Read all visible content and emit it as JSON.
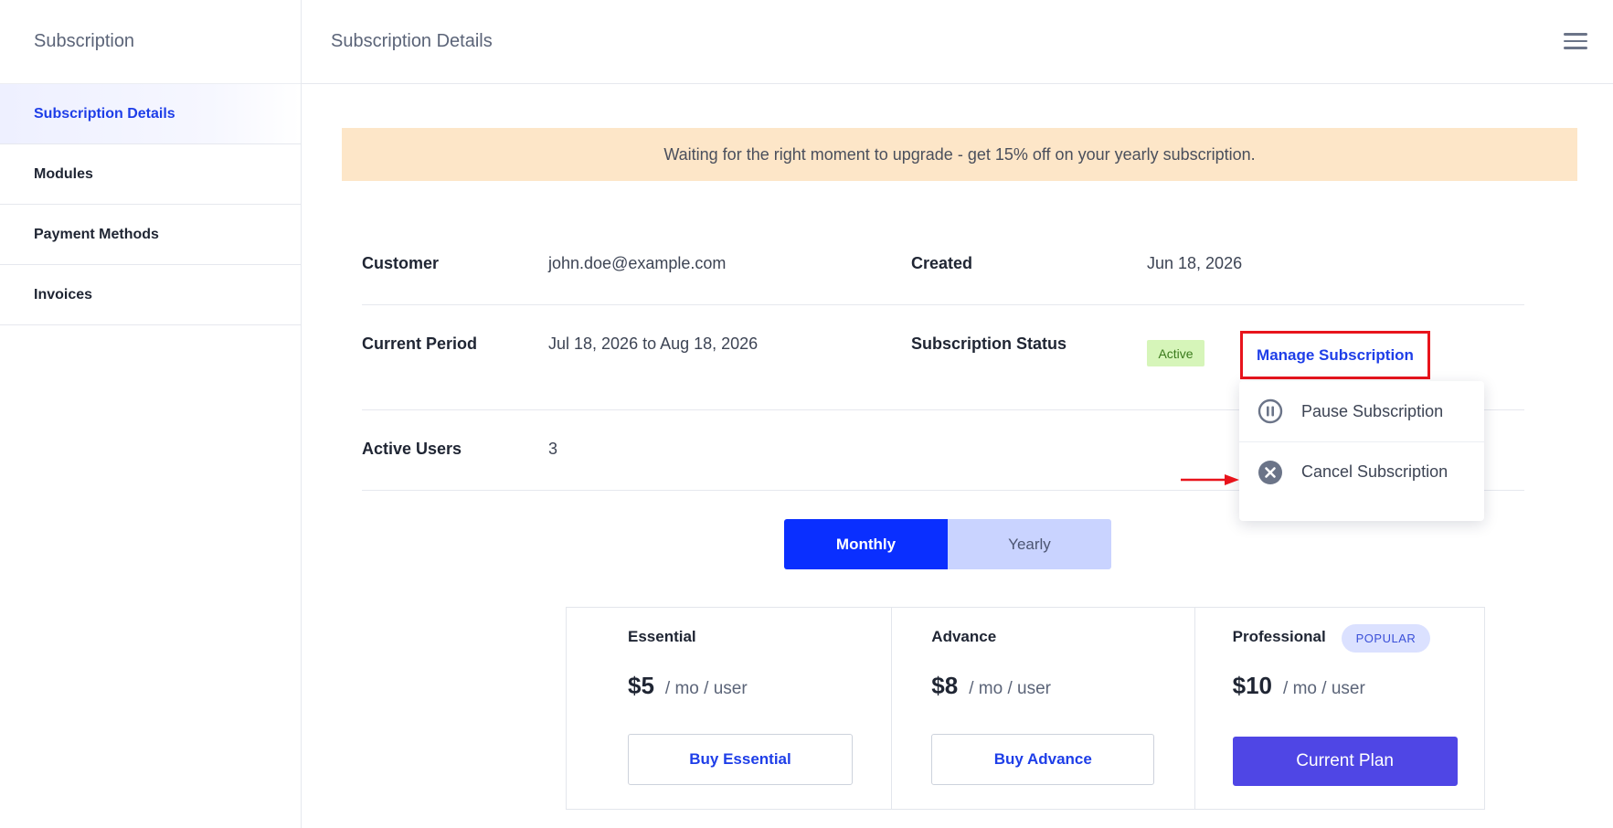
{
  "sidebar": {
    "title": "Subscription",
    "items": [
      {
        "label": "Subscription Details",
        "active": true
      },
      {
        "label": "Modules",
        "active": false
      },
      {
        "label": "Payment Methods",
        "active": false
      },
      {
        "label": "Invoices",
        "active": false
      }
    ]
  },
  "header": {
    "title": "Subscription Details",
    "menu_icon": "hamburger-menu-icon"
  },
  "banner": {
    "text": "Waiting for the right moment to upgrade - get 15% off on your yearly subscription."
  },
  "details": {
    "customer_label": "Customer",
    "customer_value": "john.doe@example.com",
    "created_label": "Created",
    "created_value": "Jun 18, 2026",
    "period_label": "Current Period",
    "period_value": "Jul 18, 2026 to Aug 18, 2026",
    "status_label": "Subscription Status",
    "status_value": "Active",
    "users_label": "Active Users",
    "users_value": "3"
  },
  "manage": {
    "label": "Manage Subscription",
    "menu": [
      {
        "label": "Pause Subscription",
        "icon": "pause-circle-icon"
      },
      {
        "label": "Cancel Subscription",
        "icon": "cancel-circle-icon"
      }
    ]
  },
  "billing_toggle": {
    "monthly": "Monthly",
    "yearly": "Yearly",
    "selected": "Monthly"
  },
  "plans": [
    {
      "name": "Essential",
      "price": "$5",
      "unit": "/ mo / user",
      "button": "Buy Essential",
      "current": false
    },
    {
      "name": "Advance",
      "price": "$8",
      "unit": "/ mo / user",
      "button": "Buy Advance",
      "current": false
    },
    {
      "name": "Professional",
      "price": "$10",
      "unit": "/ mo / user",
      "button": "Current Plan",
      "current": true,
      "badge": "POPULAR"
    }
  ],
  "colors": {
    "accent": "#1e3ee8",
    "banner_bg": "#fde6c8",
    "status_active_bg": "#d6f5b9",
    "highlight_red": "#e8141c",
    "current_plan_bg": "#4f46e5"
  }
}
